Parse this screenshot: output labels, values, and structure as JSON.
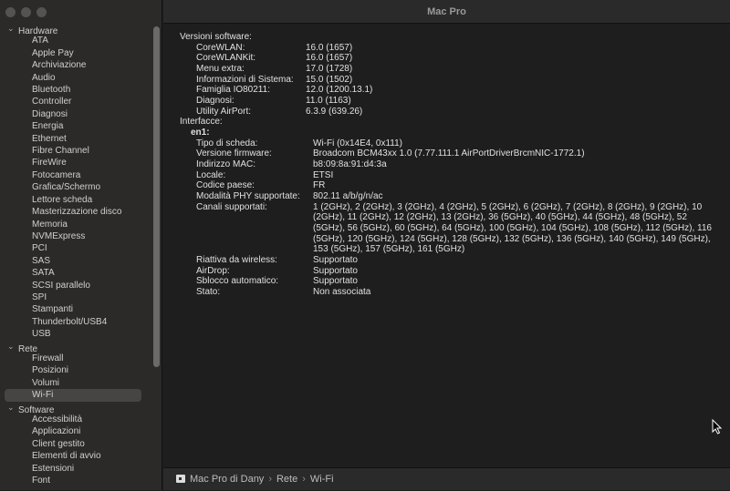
{
  "window": {
    "title": "Mac Pro"
  },
  "sidebar": {
    "groups": [
      {
        "label": "Hardware",
        "items": [
          "ATA",
          "Apple Pay",
          "Archiviazione",
          "Audio",
          "Bluetooth",
          "Controller",
          "Diagnosi",
          "Energia",
          "Ethernet",
          "Fibre Channel",
          "FireWire",
          "Fotocamera",
          "Grafica/Schermo",
          "Lettore scheda",
          "Masterizzazione disco",
          "Memoria",
          "NVMExpress",
          "PCI",
          "SAS",
          "SATA",
          "SCSI parallelo",
          "SPI",
          "Stampanti",
          "Thunderbolt/USB4",
          "USB"
        ]
      },
      {
        "label": "Rete",
        "items": [
          "Firewall",
          "Posizioni",
          "Volumi",
          "Wi-Fi"
        ]
      },
      {
        "label": "Software",
        "items": [
          "Accessibilità",
          "Applicazioni",
          "Client gestito",
          "Elementi di avvio",
          "Estensioni",
          "Font"
        ]
      }
    ],
    "selected": "Wi-Fi"
  },
  "content": {
    "software_header": "Versioni software:",
    "software": [
      [
        "CoreWLAN:",
        "16.0 (1657)"
      ],
      [
        "CoreWLANKit:",
        "16.0 (1657)"
      ],
      [
        "Menu extra:",
        "17.0 (1728)"
      ],
      [
        "Informazioni di Sistema:",
        "15.0 (1502)"
      ],
      [
        "Famiglia IO80211:",
        "12.0 (1200.13.1)"
      ],
      [
        "Diagnosi:",
        "11.0 (1163)"
      ],
      [
        "Utility AirPort:",
        "6.3.9 (639.26)"
      ]
    ],
    "interfaces_header": "Interfacce:",
    "interface_name": "en1:",
    "interface": [
      [
        "Tipo di scheda:",
        "Wi-Fi  (0x14E4, 0x111)"
      ],
      [
        "Versione firmware:",
        "Broadcom BCM43xx 1.0 (7.77.111.1 AirPortDriverBrcmNIC-1772.1)"
      ],
      [
        "Indirizzo MAC:",
        "b8:09:8a:91:d4:3a"
      ],
      [
        "Locale:",
        "ETSI"
      ],
      [
        "Codice paese:",
        "FR"
      ],
      [
        "Modalità PHY supportate:",
        "802.11 a/b/g/n/ac"
      ]
    ],
    "channels_label": "Canali supportati:",
    "channels": "1 (2GHz), 2 (2GHz), 3 (2GHz), 4 (2GHz), 5 (2GHz), 6 (2GHz), 7 (2GHz), 8 (2GHz), 9 (2GHz), 10 (2GHz), 11 (2GHz), 12 (2GHz), 13 (2GHz), 36 (5GHz), 40 (5GHz), 44 (5GHz), 48 (5GHz), 52 (5GHz), 56 (5GHz), 60 (5GHz), 64 (5GHz), 100 (5GHz), 104 (5GHz), 108 (5GHz), 112 (5GHz), 116 (5GHz), 120 (5GHz), 124 (5GHz), 128 (5GHz), 132 (5GHz), 136 (5GHz), 140 (5GHz), 149 (5GHz), 153 (5GHz), 157 (5GHz), 161 (5GHz)",
    "interface_tail": [
      [
        "Riattiva da wireless:",
        "Supportato"
      ],
      [
        "AirDrop:",
        "Supportato"
      ],
      [
        "Sblocco automatico:",
        "Supportato"
      ],
      [
        "Stato:",
        "Non associata"
      ]
    ]
  },
  "breadcrumb": [
    "Mac Pro di Dany",
    "Rete",
    "Wi-Fi"
  ]
}
